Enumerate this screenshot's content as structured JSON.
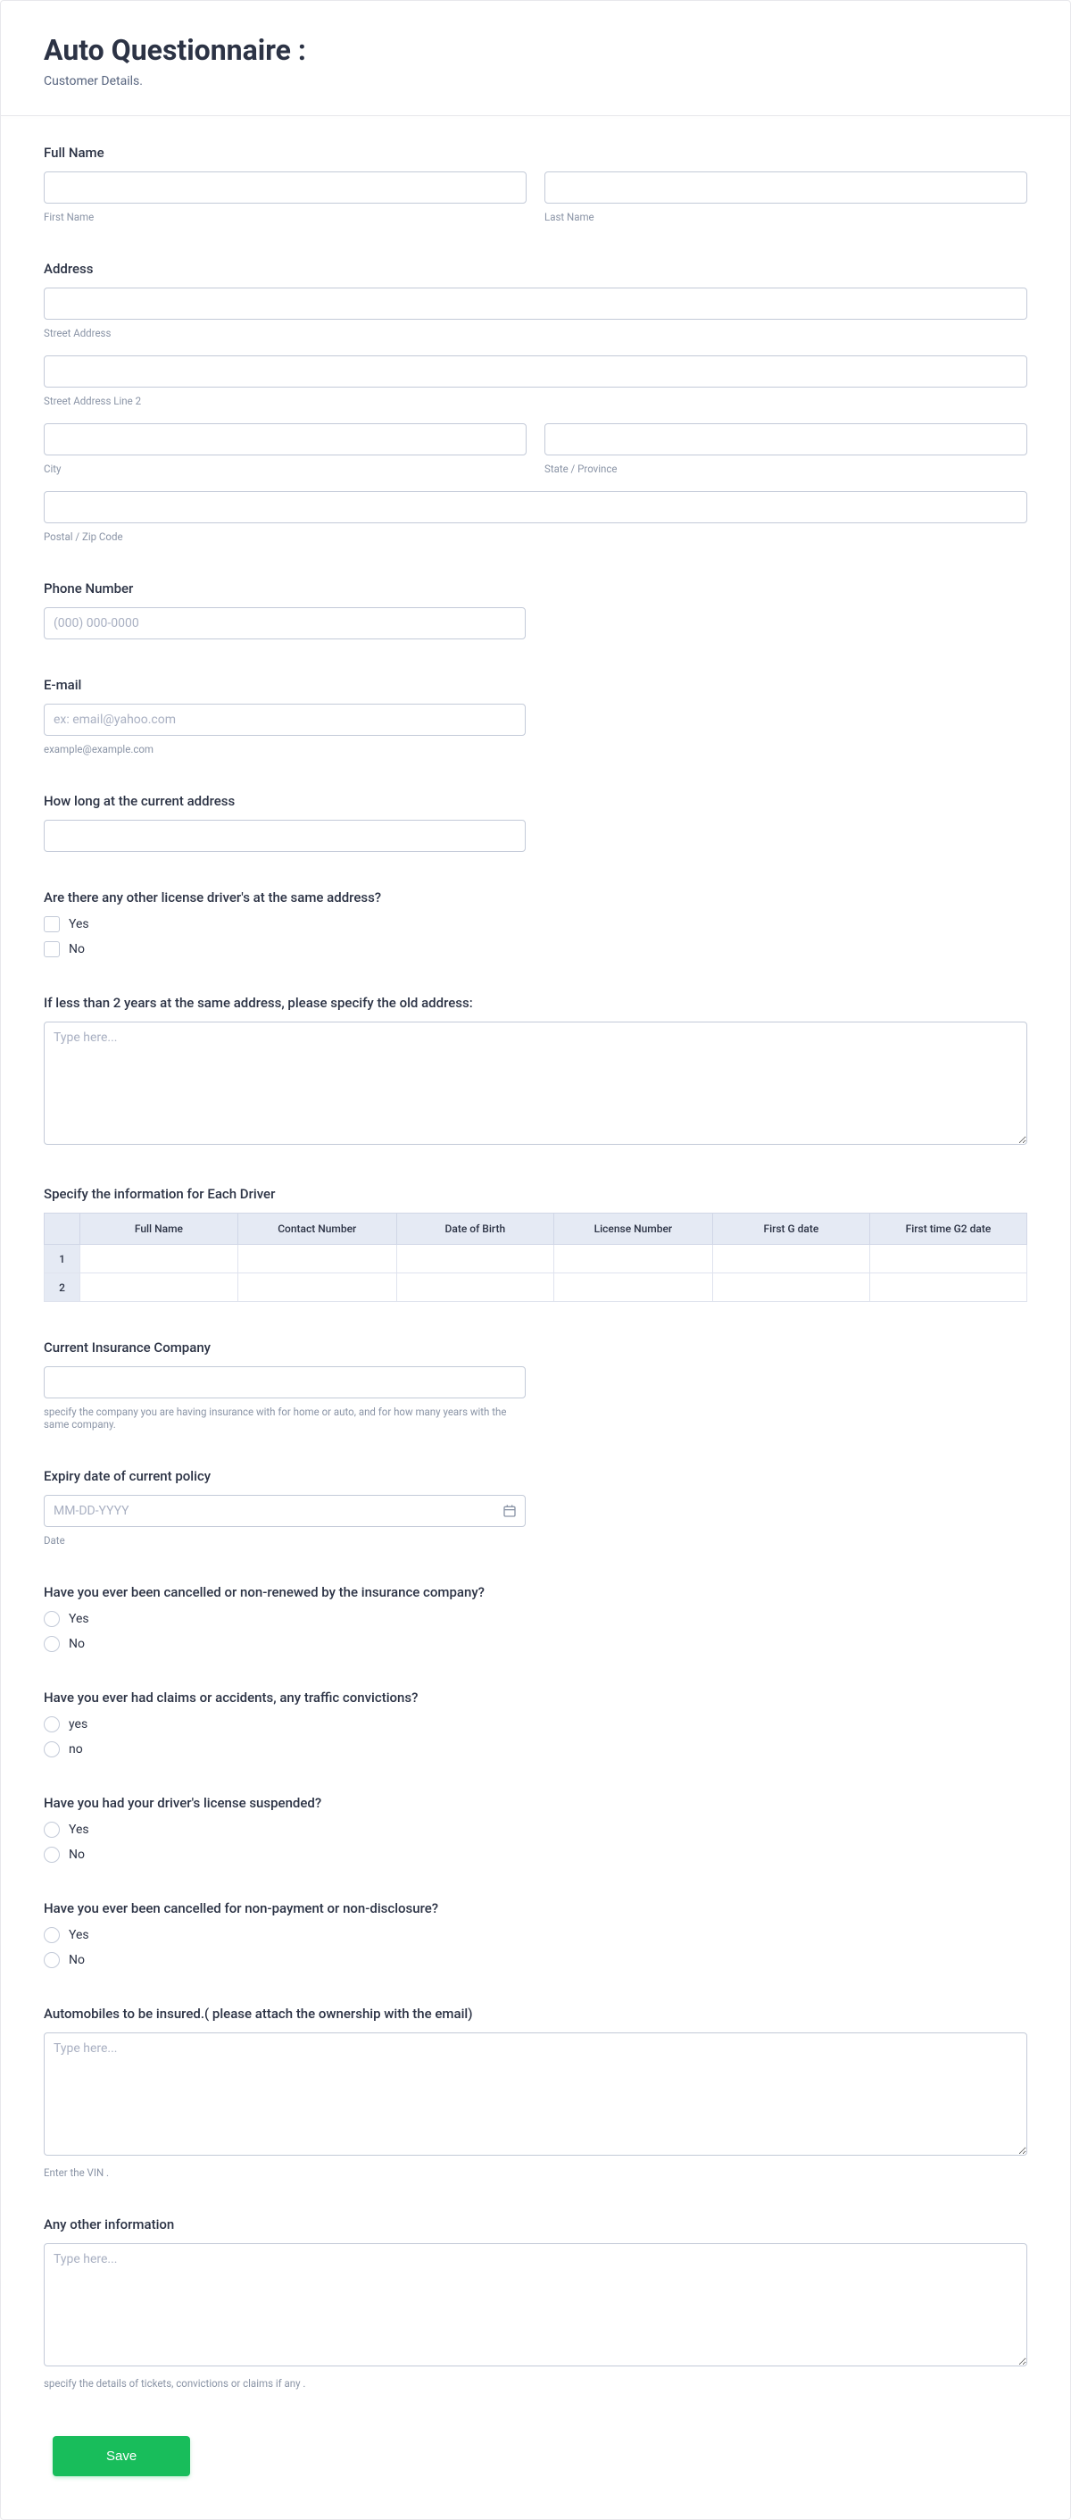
{
  "header": {
    "title": "Auto Questionnaire :",
    "subtitle": "Customer Details."
  },
  "fullName": {
    "label": "Full Name",
    "first_sub": "First Name",
    "last_sub": "Last Name"
  },
  "address": {
    "label": "Address",
    "street_sub": "Street Address",
    "street2_sub": "Street Address Line 2",
    "city_sub": "City",
    "state_sub": "State / Province",
    "postal_sub": "Postal / Zip Code"
  },
  "phone": {
    "label": "Phone Number",
    "placeholder": "(000) 000-0000"
  },
  "email": {
    "label": "E-mail",
    "placeholder": "ex: email@yahoo.com",
    "sub": "example@example.com"
  },
  "howLong": {
    "label": "How long at the current address"
  },
  "otherDrivers": {
    "label": "Are there any other license driver's at the same address?",
    "opt_yes": "Yes",
    "opt_no": "No"
  },
  "oldAddress": {
    "label": "If less than 2 years at the same address, please specify the old address:",
    "placeholder": "Type here..."
  },
  "driverTable": {
    "label": "Specify the information for Each Driver",
    "col1": "Full Name",
    "col2": "Contact Number",
    "col3": "Date of Birth",
    "col4": "License Number",
    "col5": "First G date",
    "col6": "First time G2 date",
    "r1": "1",
    "r2": "2"
  },
  "insuranceCo": {
    "label": "Current Insurance Company",
    "sub": "specify the company you are having insurance with for home or auto, and for how many years with the same company."
  },
  "expiry": {
    "label": "Expiry date of current policy",
    "placeholder": "MM-DD-YYYY",
    "sub": "Date"
  },
  "cancelled": {
    "label": "Have you ever been cancelled or non-renewed by the insurance company?",
    "opt_yes": "Yes",
    "opt_no": "No"
  },
  "claims": {
    "label": "Have you ever had claims or accidents, any traffic convictions?",
    "opt_yes": "yes",
    "opt_no": "no"
  },
  "suspended": {
    "label": "Have you had your driver's license suspended?",
    "opt_yes": "Yes",
    "opt_no": "No"
  },
  "nonpayment": {
    "label": "Have you ever been cancelled for non-payment or non-disclosure?",
    "opt_yes": "Yes",
    "opt_no": "No"
  },
  "autos": {
    "label": "Automobiles to be insured.( please attach the ownership with the email)",
    "placeholder": "Type here...",
    "sub": "Enter the VIN ."
  },
  "otherInfo": {
    "label": "Any other information",
    "placeholder": "Type here...",
    "sub": "specify the details of tickets, convictions or claims if any ."
  },
  "save": {
    "label": "Save"
  }
}
